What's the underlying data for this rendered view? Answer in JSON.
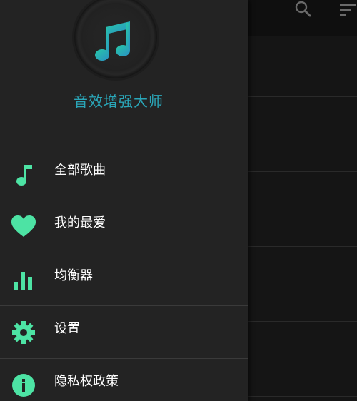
{
  "app": {
    "title": "音效增强大师"
  },
  "background": {
    "toolbar_icons": [
      "search-icon",
      "sort-icon"
    ]
  },
  "drawer": {
    "items": [
      {
        "label": "全部歌曲",
        "icon": "music-note-icon"
      },
      {
        "label": "我的最爱",
        "icon": "heart-icon"
      },
      {
        "label": "均衡器",
        "icon": "equalizer-icon"
      },
      {
        "label": "设置",
        "icon": "gear-icon"
      },
      {
        "label": "隐私权政策",
        "icon": "info-icon"
      }
    ]
  },
  "colors": {
    "accent_green": "#4de3a4",
    "title_teal": "#2aa6b8",
    "drawer_bg": "#232323"
  }
}
